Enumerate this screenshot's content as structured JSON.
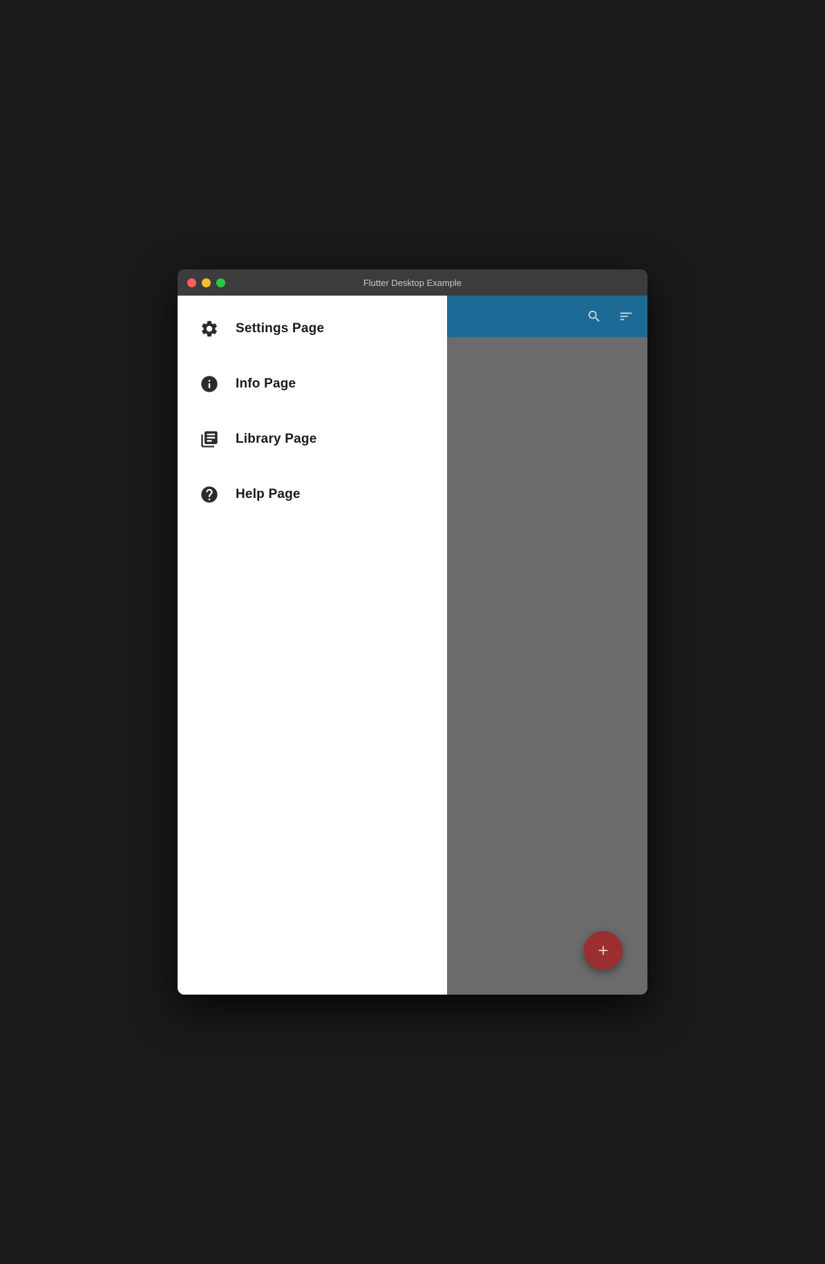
{
  "window": {
    "title": "Flutter Desktop Example",
    "controls": {
      "close": "close",
      "minimize": "minimize",
      "maximize": "maximize"
    }
  },
  "sidebar": {
    "items": [
      {
        "id": "settings",
        "label": "Settings Page",
        "icon": "gear-icon"
      },
      {
        "id": "info",
        "label": "Info Page",
        "icon": "info-icon"
      },
      {
        "id": "library",
        "label": "Library Page",
        "icon": "library-icon"
      },
      {
        "id": "help",
        "label": "Help Page",
        "icon": "help-icon"
      }
    ]
  },
  "topbar": {
    "search_label": "search",
    "filter_label": "filter"
  },
  "fab": {
    "label": "+"
  },
  "colors": {
    "topbar": "#1e6a96",
    "sidebar": "#ffffff",
    "content": "#6b6b6b",
    "fab": "#9b2e2e"
  }
}
